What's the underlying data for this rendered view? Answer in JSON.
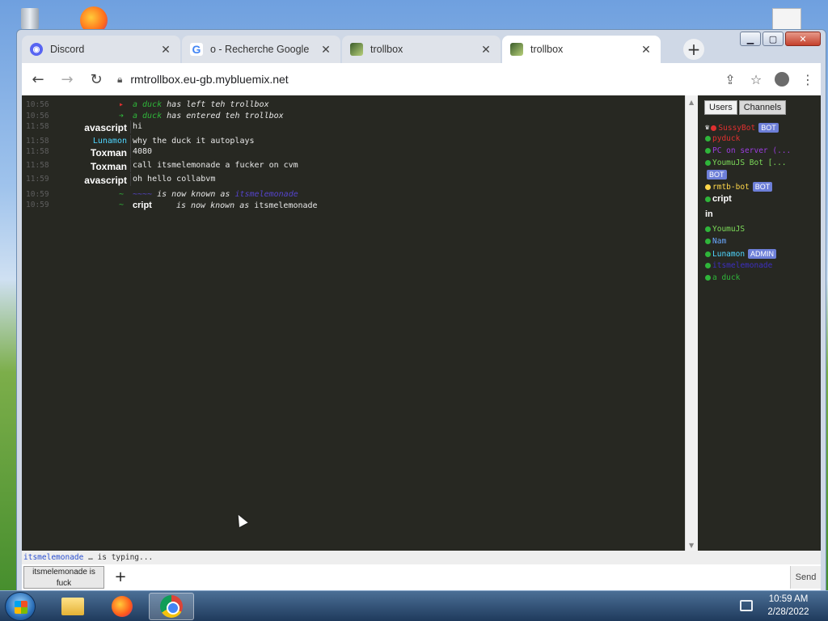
{
  "browser": {
    "tabs": [
      {
        "label": "Discord",
        "favicon": "discord-icon",
        "active": false
      },
      {
        "label": "o - Recherche Google",
        "favicon": "google-icon",
        "active": false
      },
      {
        "label": "trollbox",
        "favicon": "trollbox-icon",
        "active": false
      },
      {
        "label": "trollbox",
        "favicon": "trollbox-icon",
        "active": true
      }
    ],
    "url": "rmtrollbox.eu-gb.mybluemix.net"
  },
  "chat": {
    "messages": [
      {
        "time": "10:56",
        "kind": "left",
        "user": "a duck",
        "text": "has left teh trollbox"
      },
      {
        "time": "10:56",
        "kind": "entered",
        "user": "a duck",
        "text": "has entered teh trollbox"
      },
      {
        "time": "11:58",
        "kind": "msg",
        "nick": "avascript",
        "text": "hi"
      },
      {
        "time": "11:58",
        "kind": "msg",
        "nick": "Lunamon",
        "text": "why the duck it autoplays"
      },
      {
        "time": "11:58",
        "kind": "msg",
        "nick": "Toxman",
        "text": "4080"
      },
      {
        "time": "11:58",
        "kind": "msg",
        "nick": "Toxman",
        "text": "call itsmelemonade a fucker on cvm"
      },
      {
        "time": "11:59",
        "kind": "msg",
        "nick": "avascript",
        "text": "oh hello collabvm"
      },
      {
        "time": "10:59",
        "kind": "rename",
        "user": "~~~~",
        "text": "is now known as",
        "newname": "itsmelemonade"
      },
      {
        "time": "10:59",
        "kind": "rename",
        "user": "cript",
        "text": "is now known as",
        "newname": "itsmelemonade"
      }
    ],
    "typing_user": "itsmelemonade",
    "typing_suffix": "… is typing..."
  },
  "sidebar": {
    "tabs": {
      "users": "Users",
      "channels": "Channels"
    },
    "users": [
      {
        "name": "SussyBot",
        "color": "#e03030",
        "dot": "#e03030",
        "badge": "BOT",
        "crown": true
      },
      {
        "name": "pyduck",
        "color": "#e03030",
        "dot": "#2fb53a"
      },
      {
        "name": "PC on server (...",
        "color": "#9b3de0",
        "dot": "#2fb53a"
      },
      {
        "name": "YoumuJS Bot [...",
        "color": "#7ddc5a",
        "dot": "#2fb53a"
      },
      {
        "name": "rmtb-bot",
        "color": "#ffd74a",
        "dot": "#ffd74a",
        "badge": "BOT"
      },
      {
        "name": "cript",
        "color": "#ffffff",
        "dot": "#2fb53a"
      },
      {
        "name": "in",
        "color": "#ffffff",
        "dot": ""
      },
      {
        "name": "YoumuJS",
        "color": "#7ddc5a",
        "dot": "#2fb53a"
      },
      {
        "name": "Nam",
        "color": "#6aa8ff",
        "dot": "#2fb53a"
      },
      {
        "name": "Lunamon",
        "color": "#4fd6ff",
        "dot": "#2fb53a",
        "badge": "ADMIN"
      },
      {
        "name": "itsmelemonade",
        "color": "#3d2fc0",
        "dot": "#2fb53a"
      },
      {
        "name": "a duck",
        "color": "#2fb53a",
        "dot": "#2fb53a"
      }
    ],
    "bot_badge_2": "BOT"
  },
  "input": {
    "channel_label": "itsmelemonade is fuck",
    "add_label": "+",
    "send_label": "Send",
    "value": ""
  },
  "taskbar": {
    "time": "10:59 AM",
    "date": "2/28/2022"
  },
  "colors": {
    "chat_bg": "#272822",
    "accent_badge": "#6d7fd8"
  }
}
